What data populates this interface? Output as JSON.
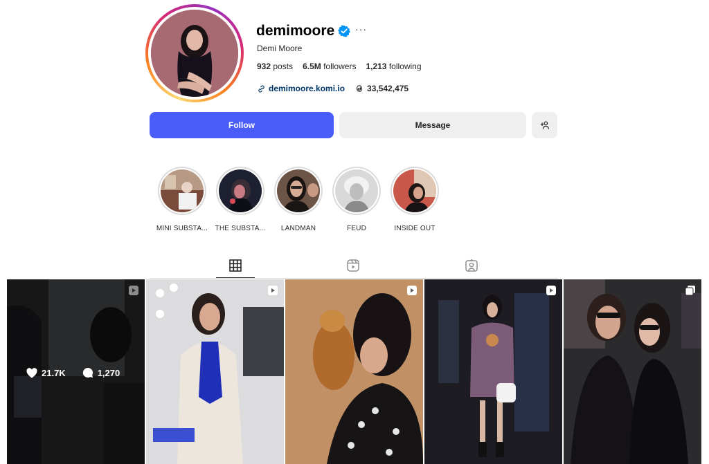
{
  "profile": {
    "username": "demimoore",
    "full_name": "Demi Moore",
    "more_label": "···",
    "stats": {
      "posts_count": "932",
      "posts_label": "posts",
      "followers_count": "6.5M",
      "followers_label": "followers",
      "following_count": "1,213",
      "following_label": "following"
    },
    "website": "demimoore.komi.io",
    "threads_count": "33,542,475"
  },
  "actions": {
    "follow_label": "Follow",
    "message_label": "Message",
    "add_user_icon": "person-plus-icon"
  },
  "highlights": [
    {
      "label": "MINI SUBSTA..."
    },
    {
      "label": "THE SUBSTA..."
    },
    {
      "label": "LANDMAN"
    },
    {
      "label": "FEUD"
    },
    {
      "label": "INSIDE OUT"
    }
  ],
  "tabs": [
    {
      "icon": "grid-icon",
      "active": true
    },
    {
      "icon": "reels-icon",
      "active": false
    },
    {
      "icon": "tagged-icon",
      "active": false
    }
  ],
  "posts": [
    {
      "type": "reel",
      "hovered": true,
      "likes": "21.7K",
      "comments": "1,270"
    },
    {
      "type": "reel"
    },
    {
      "type": "reel"
    },
    {
      "type": "reel"
    },
    {
      "type": "carousel"
    }
  ],
  "colors": {
    "follow_button": "#4a5df9",
    "secondary_button": "#efeff0",
    "link": "#00376b",
    "verified": "#0095f6"
  }
}
